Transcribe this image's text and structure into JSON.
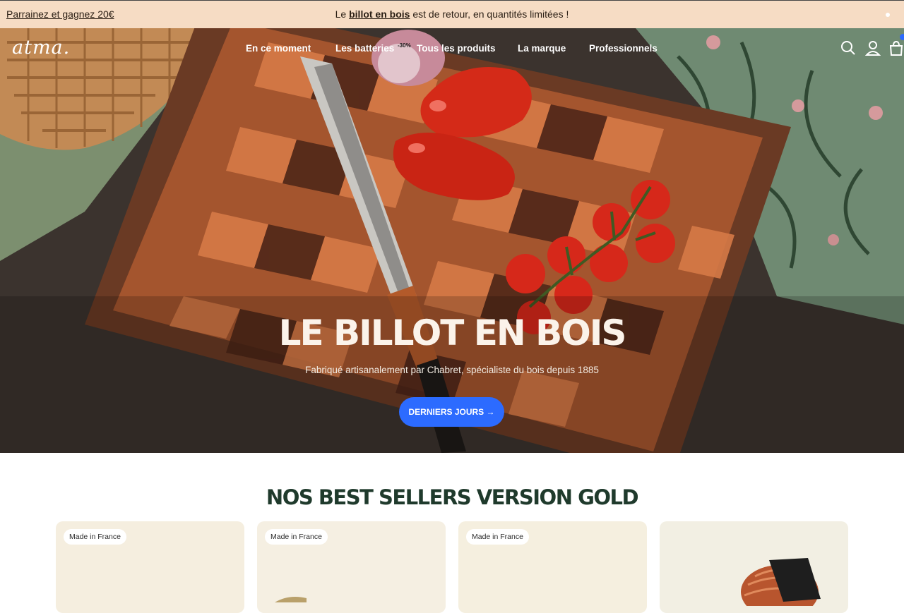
{
  "announcement": {
    "referral_link": "Parrainez et gagnez 20€",
    "message_prefix": "Le ",
    "message_bold": "billot en bois",
    "message_suffix": " est de retour, en quantités limitées !"
  },
  "header": {
    "logo": "atma.",
    "nav": [
      {
        "label": "En ce moment"
      },
      {
        "label": "Les batteries"
      },
      {
        "label": "Tous les produits"
      },
      {
        "label": "La marque"
      },
      {
        "label": "Professionnels"
      }
    ],
    "nav_badge": "-30%",
    "icons": [
      "search-icon",
      "account-icon",
      "cart-icon"
    ]
  },
  "hero": {
    "title": "LE BILLOT EN BOIS",
    "subtitle": "Fabriqué artisanalement par Chabret, spécialiste du bois depuis 1885",
    "cta_label": "DERNIERS JOURS →"
  },
  "best_sellers": {
    "title": "NOS BEST SELLERS VERSION GOLD",
    "cards": [
      {
        "badge": "Made in France"
      },
      {
        "badge": "Made in France"
      },
      {
        "badge": "Made in France"
      },
      {
        "badge": ""
      }
    ]
  },
  "colors": {
    "announcement_bg": "#f6dcc4",
    "accent_blue": "#2c6bff",
    "section_title": "#1f3a2c",
    "card_bg": "#f5eedf"
  }
}
